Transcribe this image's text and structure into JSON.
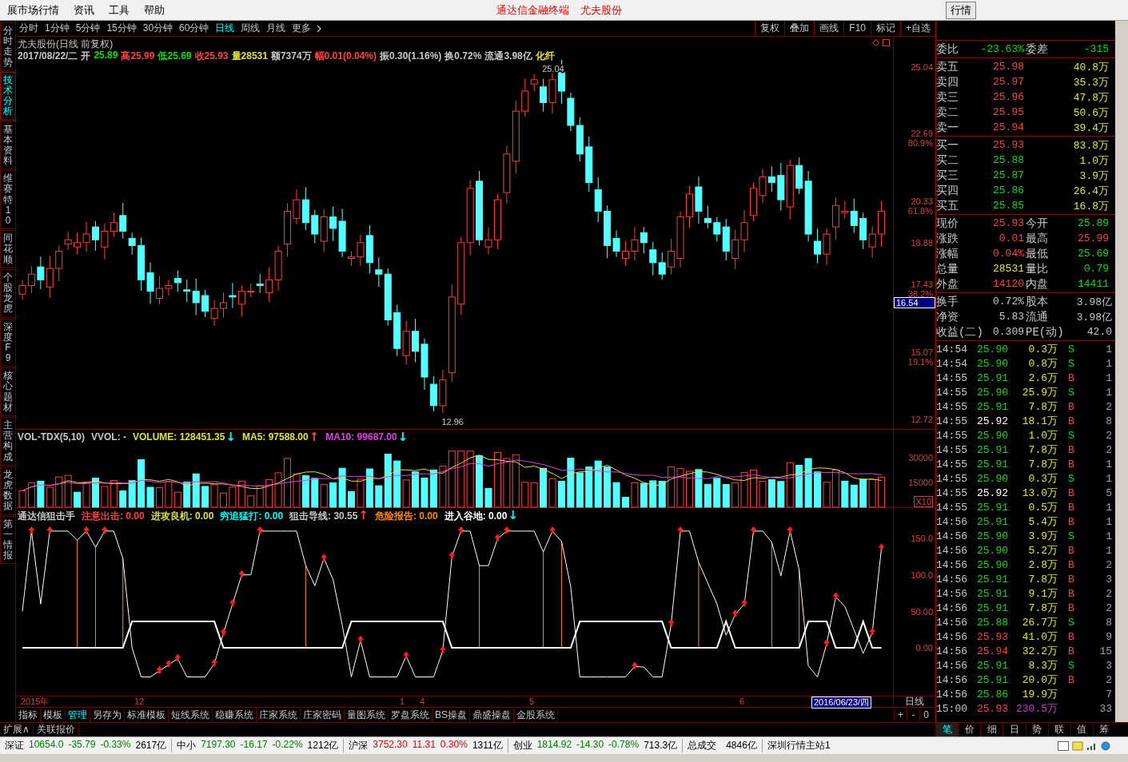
{
  "menu": [
    "展市场行情",
    "资讯",
    "工具",
    "帮助"
  ],
  "title_center": [
    {
      "text": "通达信金融终端"
    },
    {
      "text": "尤夫股份"
    }
  ],
  "top_button": "行情",
  "side_tabs": [
    {
      "label": "分时走势",
      "selected": false
    },
    {
      "label": "技术分析",
      "selected": true
    },
    {
      "label": "基本资料",
      "selected": false
    },
    {
      "label": "维赛特10",
      "selected": false
    },
    {
      "label": "同花顺",
      "selected": false
    },
    {
      "label": "个股龙虎",
      "selected": false
    },
    {
      "label": "深度F9",
      "selected": false
    },
    {
      "label": "核心题材",
      "selected": false
    },
    {
      "label": "主营构成",
      "selected": false
    },
    {
      "label": "龙虎数据",
      "selected": false
    },
    {
      "label": "第一情报",
      "selected": false
    }
  ],
  "periods": [
    {
      "label": "分时",
      "selected": false
    },
    {
      "label": "1分钟",
      "selected": false
    },
    {
      "label": "5分钟",
      "selected": false
    },
    {
      "label": "15分钟",
      "selected": false
    },
    {
      "label": "30分钟",
      "selected": false
    },
    {
      "label": "60分钟",
      "selected": false
    },
    {
      "label": "日线",
      "selected": true
    },
    {
      "label": "周线",
      "selected": false
    },
    {
      "label": "月线",
      "selected": false
    },
    {
      "label": "更多",
      "selected": false
    }
  ],
  "toolbar_buttons": [
    "复权",
    "叠加",
    "画线",
    "F10",
    "标记",
    "+自选"
  ],
  "price_chart": {
    "title": "尤夫股份(日线 前复权)",
    "info": [
      {
        "text": "2017/08/22/二",
        "color": "#c8c8c8"
      },
      {
        "text": "开",
        "color": "#c8c8c8"
      },
      {
        "text": "25.89",
        "color": "#00e000"
      },
      {
        "text": "高25.99",
        "color": "#ff4040"
      },
      {
        "text": "低25.69",
        "color": "#00e000"
      },
      {
        "text": "收25.93",
        "color": "#ff4040"
      },
      {
        "text": "量28531",
        "color": "#e0e040"
      },
      {
        "text": "额7374万",
        "color": "#c8c8c8"
      },
      {
        "text": "幅0.01(0.04%)",
        "color": "#ff4040"
      },
      {
        "text": "振0.30(1.16%)",
        "color": "#c8c8c8"
      },
      {
        "text": "换0.72%",
        "color": "#c8c8c8"
      },
      {
        "text": "流通3.98亿",
        "color": "#c8c8c8"
      },
      {
        "text": "化纤",
        "color": "#e0e040"
      }
    ],
    "high_label": "25.04",
    "low_label": "12.96",
    "axis": [
      {
        "text": "25.04",
        "kind": "price"
      },
      {
        "text": "22.69",
        "kind": "price"
      },
      {
        "text": "80.9%",
        "kind": "ratio"
      },
      {
        "text": "20.33",
        "kind": "price"
      },
      {
        "text": "61.8%",
        "kind": "ratio"
      },
      {
        "text": "18.88",
        "kind": "price"
      },
      {
        "text": "17.43",
        "kind": "price"
      },
      {
        "text": "38.2%",
        "kind": "ratio"
      },
      {
        "text": "16.54",
        "kind": "cursor"
      },
      {
        "text": "15.07",
        "kind": "price"
      },
      {
        "text": "19.1%",
        "kind": "ratio"
      },
      {
        "text": "12.72",
        "kind": "price"
      }
    ]
  },
  "volume_chart": {
    "legend": [
      {
        "text": "VOL-TDX(5,10)",
        "color": "#c8c8c8",
        "kind": "label"
      },
      {
        "text": "VVOL: -",
        "color": "#c8c8c8",
        "kind": "label"
      },
      {
        "text": "VOLUME: 128451.35",
        "color": "#e0e040",
        "kind": "label"
      },
      {
        "text": "↓",
        "color": "#00ffff",
        "kind": "arrow"
      },
      {
        "text": "MA5: 97588.00",
        "color": "#e0e040",
        "kind": "label"
      },
      {
        "text": "↑",
        "color": "#ff4040",
        "kind": "arrow"
      },
      {
        "text": "MA10: 99687.00",
        "color": "#e040e0",
        "kind": "label"
      },
      {
        "text": "↓",
        "color": "#00ffff",
        "kind": "arrow"
      }
    ],
    "axis": [
      {
        "text": "30000",
        "kind": "price"
      },
      {
        "text": "15000",
        "kind": "price"
      },
      {
        "text": "X10",
        "kind": "unit"
      }
    ]
  },
  "indicator_chart": {
    "legend": [
      {
        "text": "通达信狙击手",
        "color": "#c8c8c8",
        "kind": "label"
      },
      {
        "text": "注意出击: 0.00",
        "color": "#ff4040",
        "kind": "label"
      },
      {
        "text": "进攻良机: 0.00",
        "color": "#e0e040",
        "kind": "label"
      },
      {
        "text": "穷追猛打: 0.00",
        "color": "#00ffff",
        "kind": "label"
      },
      {
        "text": "狙击导线: 30.55",
        "color": "#c8c8c8",
        "kind": "label"
      },
      {
        "text": "↑",
        "color": "#ff4040",
        "kind": "arrow"
      },
      {
        "text": "危险报告: 0.00",
        "color": "#ff8c00",
        "kind": "label"
      },
      {
        "text": "进入谷地: 0.00",
        "color": "#ffffff",
        "kind": "label"
      },
      {
        "text": "↓",
        "color": "#00ffff",
        "kind": "arrow"
      }
    ],
    "axis": [
      {
        "text": "150.0",
        "kind": "price"
      },
      {
        "text": "100.0",
        "kind": "price"
      },
      {
        "text": "50.00",
        "kind": "price"
      },
      {
        "text": "0.00",
        "kind": "price"
      }
    ]
  },
  "date_axis": [
    {
      "text": "2015年",
      "kind": "date"
    },
    {
      "text": "12",
      "kind": "date"
    },
    {
      "text": "1",
      "kind": "date"
    },
    {
      "text": "4",
      "kind": "date"
    },
    {
      "text": "5",
      "kind": "date"
    },
    {
      "text": "6",
      "kind": "date"
    },
    {
      "text": "2016/06/23/四",
      "kind": "cursor"
    }
  ],
  "period_label": "日线",
  "template_tabs": [
    {
      "label": "指标",
      "selected": false
    },
    {
      "label": "模板",
      "selected": false
    },
    {
      "label": "管理",
      "selected": true
    },
    {
      "label": "另存为",
      "selected": false
    },
    {
      "label": "标准模板",
      "selected": false
    },
    {
      "label": "短线系统",
      "selected": false
    },
    {
      "label": "稳赚系统",
      "selected": false
    },
    {
      "label": "庄家系统",
      "selected": false
    },
    {
      "label": "庄家密码",
      "selected": false
    },
    {
      "label": "量图系统",
      "selected": false
    },
    {
      "label": "罗盘系统",
      "selected": false
    },
    {
      "label": "BS操盘",
      "selected": false
    },
    {
      "label": "鼎盛操盘",
      "selected": false
    },
    {
      "label": "金股系统",
      "selected": false
    }
  ],
  "zoom_buttons": [
    "+",
    "-",
    "0"
  ],
  "order_ratio": {
    "label": "委比",
    "value": "-23.63%",
    "label2": "委差",
    "value2": "-315"
  },
  "asks": [
    {
      "label": "卖五",
      "price": "25.98",
      "color": "#ff4040",
      "volume": "40.8万"
    },
    {
      "label": "卖四",
      "price": "25.97",
      "color": "#ff4040",
      "volume": "35.3万"
    },
    {
      "label": "卖三",
      "price": "25.96",
      "color": "#ff4040",
      "volume": "47.8万"
    },
    {
      "label": "卖二",
      "price": "25.95",
      "color": "#ff4040",
      "volume": "50.6万"
    },
    {
      "label": "卖一",
      "price": "25.94",
      "color": "#ff4040",
      "volume": "39.4万"
    }
  ],
  "bids": [
    {
      "label": "买一",
      "price": "25.93",
      "color": "#ff4040",
      "volume": "83.8万"
    },
    {
      "label": "买二",
      "price": "25.88",
      "color": "#00e000",
      "volume": "1.0万"
    },
    {
      "label": "买三",
      "price": "25.87",
      "color": "#00e000",
      "volume": "3.9万"
    },
    {
      "label": "买四",
      "price": "25.86",
      "color": "#00e000",
      "volume": "26.4万"
    },
    {
      "label": "买五",
      "price": "25.85",
      "color": "#00e000",
      "volume": "16.8万"
    }
  ],
  "quote_stats": [
    {
      "left": {
        "label": "现价",
        "value": "25.93",
        "color": "#ff4040"
      },
      "right": {
        "label": "今开",
        "value": "25.89",
        "color": "#00e000"
      }
    },
    {
      "left": {
        "label": "涨跌",
        "value": "0.01",
        "color": "#ff4040"
      },
      "right": {
        "label": "最高",
        "value": "25.99",
        "color": "#ff4040"
      }
    },
    {
      "left": {
        "label": "涨幅",
        "value": "0.04%",
        "color": "#ff4040"
      },
      "right": {
        "label": "最低",
        "value": "25.69",
        "color": "#00e000"
      }
    },
    {
      "left": {
        "label": "总量",
        "value": "28531",
        "color": "#e0e040"
      },
      "right": {
        "label": "量比",
        "value": "0.79",
        "color": "#00e000"
      }
    },
    {
      "left": {
        "label": "外盘",
        "value": "14120",
        "color": "#ff4040"
      },
      "right": {
        "label": "内盘",
        "value": "14411",
        "color": "#00e000"
      }
    }
  ],
  "company_stats": [
    {
      "label": "换手",
      "value": "0.72%",
      "label2": "股本",
      "value2": "3.98亿"
    },
    {
      "label": "净资",
      "value": "5.83",
      "label2": "流通",
      "value2": "3.98亿"
    },
    {
      "label": "收益(二)",
      "value": "0.309",
      "label2": "PE(动)",
      "value2": "42.0"
    }
  ],
  "ticks": [
    {
      "time": "14:54",
      "price": "25.90",
      "color": "#00e000",
      "volume": {
        "text": "0.3万",
        "color": "#e0e040"
      },
      "kind": "sell",
      "side": "S",
      "count": "1"
    },
    {
      "time": "14:54",
      "price": "25.90",
      "color": "#00e000",
      "volume": {
        "text": "0.8万",
        "color": "#e0e040"
      },
      "kind": "sell",
      "side": "S",
      "count": "1"
    },
    {
      "time": "14:55",
      "price": "25.91",
      "color": "#00e000",
      "volume": {
        "text": "2.6万",
        "color": "#e0e040"
      },
      "kind": "buy",
      "side": "B",
      "count": "1"
    },
    {
      "time": "14:55",
      "price": "25.90",
      "color": "#00e000",
      "volume": {
        "text": "25.9万",
        "color": "#e0e040"
      },
      "kind": "sell",
      "side": "S",
      "count": "1"
    },
    {
      "time": "14:55",
      "price": "25.91",
      "color": "#00e000",
      "volume": {
        "text": "7.8万",
        "color": "#e0e040"
      },
      "kind": "buy",
      "side": "B",
      "count": "2"
    },
    {
      "time": "14:55",
      "price": "25.92",
      "color": "#ffffff",
      "volume": {
        "text": "18.1万",
        "color": "#e0e040"
      },
      "kind": "buy",
      "side": "B",
      "count": "8"
    },
    {
      "time": "14:55",
      "price": "25.90",
      "color": "#00e000",
      "volume": {
        "text": "1.0万",
        "color": "#e0e040"
      },
      "kind": "sell",
      "side": "S",
      "count": "2"
    },
    {
      "time": "14:55",
      "price": "25.91",
      "color": "#00e000",
      "volume": {
        "text": "7.8万",
        "color": "#e0e040"
      },
      "kind": "buy",
      "side": "B",
      "count": "2"
    },
    {
      "time": "14:55",
      "price": "25.91",
      "color": "#00e000",
      "volume": {
        "text": "7.8万",
        "color": "#e0e040"
      },
      "kind": "buy",
      "side": "B",
      "count": "1"
    },
    {
      "time": "14:55",
      "price": "25.90",
      "color": "#00e000",
      "volume": {
        "text": "0.3万",
        "color": "#e0e040"
      },
      "kind": "sell",
      "side": "S",
      "count": "1"
    },
    {
      "time": "14:55",
      "price": "25.92",
      "color": "#ffffff",
      "volume": {
        "text": "13.0万",
        "color": "#e0e040"
      },
      "kind": "buy",
      "side": "B",
      "count": "5"
    },
    {
      "time": "14:55",
      "price": "25.91",
      "color": "#00e000",
      "volume": {
        "text": "0.5万",
        "color": "#e0e040"
      },
      "kind": "buy",
      "side": "B",
      "count": "1"
    },
    {
      "time": "14:56",
      "price": "25.91",
      "color": "#00e000",
      "volume": {
        "text": "5.4万",
        "color": "#e0e040"
      },
      "kind": "buy",
      "side": "B",
      "count": "1"
    },
    {
      "time": "14:56",
      "price": "25.90",
      "color": "#00e000",
      "volume": {
        "text": "3.9万",
        "color": "#e0e040"
      },
      "kind": "sell",
      "side": "S",
      "count": "1"
    },
    {
      "time": "14:56",
      "price": "25.90",
      "color": "#00e000",
      "volume": {
        "text": "5.2万",
        "color": "#e0e040"
      },
      "kind": "buy",
      "side": "B",
      "count": "1"
    },
    {
      "time": "14:56",
      "price": "25.90",
      "color": "#00e000",
      "volume": {
        "text": "2.8万",
        "color": "#e0e040"
      },
      "kind": "buy",
      "side": "B",
      "count": "2"
    },
    {
      "time": "14:56",
      "price": "25.91",
      "color": "#00e000",
      "volume": {
        "text": "7.8万",
        "color": "#e0e040"
      },
      "kind": "buy",
      "side": "B",
      "count": "3"
    },
    {
      "time": "14:56",
      "price": "25.91",
      "color": "#00e000",
      "volume": {
        "text": "9.1万",
        "color": "#e0e040"
      },
      "kind": "buy",
      "side": "B",
      "count": "2"
    },
    {
      "time": "14:56",
      "price": "25.91",
      "color": "#00e000",
      "volume": {
        "text": "7.8万",
        "color": "#e0e040"
      },
      "kind": "buy",
      "side": "B",
      "count": "2"
    },
    {
      "time": "14:56",
      "price": "25.88",
      "color": "#00e000",
      "volume": {
        "text": "26.7万",
        "color": "#e0e040"
      },
      "kind": "sell",
      "side": "S",
      "count": "8"
    },
    {
      "time": "14:56",
      "price": "25.93",
      "color": "#ff4040",
      "volume": {
        "text": "41.0万",
        "color": "#e0e040"
      },
      "kind": "buy",
      "side": "B",
      "count": "9"
    },
    {
      "time": "14:56",
      "price": "25.94",
      "color": "#ff4040",
      "volume": {
        "text": "32.2万",
        "color": "#e0e040"
      },
      "kind": "buy",
      "side": "B",
      "count": "15"
    },
    {
      "time": "14:56",
      "price": "25.91",
      "color": "#00e000",
      "volume": {
        "text": "8.3万",
        "color": "#e0e040"
      },
      "kind": "sell",
      "side": "S",
      "count": "3"
    },
    {
      "time": "14:56",
      "price": "25.91",
      "color": "#00e000",
      "volume": {
        "text": "20.0万",
        "color": "#e0e040"
      },
      "kind": "buy",
      "side": "B",
      "count": "2"
    },
    {
      "time": "14:56",
      "price": "25.86",
      "color": "#00e000",
      "volume": {
        "text": "19.9万",
        "color": "#e0e040"
      },
      "kind": "none",
      "count": "7"
    },
    {
      "time": "15:00",
      "price": "25.93",
      "color": "#ff4040",
      "volume": {
        "text": "230.5万",
        "color": "#c040c0"
      },
      "kind": "none",
      "count": "33"
    }
  ],
  "expand_links": [
    "扩展∧",
    "关联报价"
  ],
  "right_tabs": [
    {
      "label": "笔",
      "selected": true
    },
    {
      "label": "价",
      "selected": false
    },
    {
      "label": "细",
      "selected": false
    },
    {
      "label": "日",
      "selected": false
    },
    {
      "label": "势",
      "selected": false
    },
    {
      "label": "联",
      "selected": false
    },
    {
      "label": "值",
      "selected": false
    },
    {
      "label": "筹",
      "selected": false
    }
  ],
  "status_bar": {
    "indices": [
      {
        "label": "深证",
        "value": "10654.0",
        "change": "-35.79",
        "pct": "-0.33%",
        "amount": "2617亿",
        "color": "#008000"
      },
      {
        "label": "中小",
        "value": "7197.30",
        "change": "-16.17",
        "pct": "-0.22%",
        "amount": "1212亿",
        "color": "#008000"
      },
      {
        "label": "沪深",
        "value": "3752.30",
        "change": "11.31",
        "pct": "0.30%",
        "amount": "1311亿",
        "color": "#e00000"
      },
      {
        "label": "创业",
        "value": "1814.92",
        "change": "-14.30",
        "pct": "-0.78%",
        "amount": "713.3亿",
        "color": "#008000"
      }
    ],
    "total_label": "总成交",
    "total_value": "4846亿",
    "server": "深圳行情主站1"
  }
}
